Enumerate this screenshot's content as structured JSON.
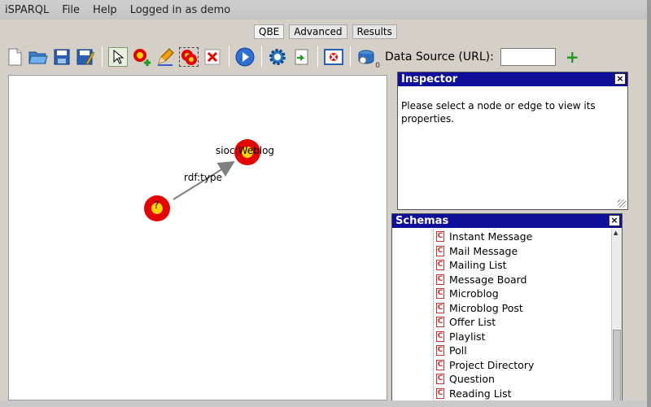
{
  "menubar": {
    "app": "iSPARQL",
    "file": "File",
    "help": "Help",
    "user": "Logged in as demo"
  },
  "tabs": [
    {
      "label": "QBE"
    },
    {
      "label": "Advanced"
    },
    {
      "label": "Results"
    }
  ],
  "toolbar": {
    "icons": [
      "new-file-icon",
      "open-folder-icon",
      "save-icon",
      "save-as-icon",
      "pointer-icon",
      "add-node-icon",
      "pencil-icon",
      "group-nodes-icon",
      "delete-icon",
      "run-icon",
      "settings-icon",
      "import-icon",
      "clear-graph-icon",
      "datasource-icon"
    ],
    "datasource_count": "0",
    "datasource_label": "Data Source (URL):",
    "datasource_value": "",
    "add_label": "+"
  },
  "graph": {
    "node_subject_label": "?",
    "node_object_label": "sioc:Weblog",
    "edge_label": "rdf:type"
  },
  "inspector": {
    "title": "Inspector",
    "close": "×",
    "message": "Please select a node or edge to view its properties."
  },
  "schemas": {
    "title": "Schemas",
    "close": "×",
    "class_icon_letter": "C",
    "items": [
      "Instant Message",
      "Mail Message",
      "Mailing List",
      "Message Board",
      "Microblog",
      "Microblog Post",
      "Offer List",
      "Playlist",
      "Poll",
      "Project Directory",
      "Question",
      "Reading List"
    ]
  },
  "colors": {
    "title_bar": "#0f0f9a",
    "node_outer": "#e60000",
    "node_inner": "#ffd400",
    "add_green": "#1a9a1a"
  }
}
